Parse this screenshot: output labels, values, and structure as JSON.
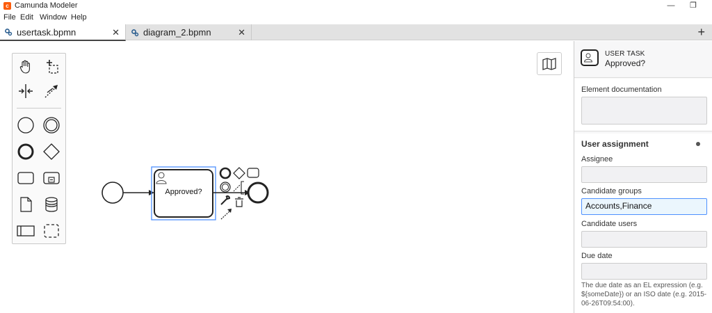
{
  "window": {
    "title": "Camunda Modeler",
    "minimize_glyph": "—",
    "restore_glyph": "❐"
  },
  "menu": [
    "File",
    "Edit",
    "Window",
    "Help"
  ],
  "tabs": [
    {
      "label": "usertask.bpmn",
      "active": true
    },
    {
      "label": "diagram_2.bpmn",
      "active": false
    }
  ],
  "tab_close_glyph": "✕",
  "add_tab_glyph": "+",
  "palette": {
    "tools": [
      "hand-tool-icon",
      "lasso-tool-icon",
      "space-tool-icon",
      "global-connect-icon",
      "start-event-icon",
      "intermediate-event-icon",
      "end-event-icon",
      "gateway-icon",
      "task-icon",
      "subprocess-icon",
      "data-object-icon",
      "data-store-icon",
      "pool-icon",
      "group-icon"
    ]
  },
  "diagram": {
    "task_label": "Approved?"
  },
  "properties": {
    "element_type": "USER TASK",
    "element_name": "Approved?",
    "documentation_label": "Element documentation",
    "documentation_value": "",
    "section_title": "User assignment",
    "fields": {
      "assignee_label": "Assignee",
      "assignee_value": "",
      "candidate_groups_label": "Candidate groups",
      "candidate_groups_value": "Accounts,Finance",
      "candidate_users_label": "Candidate users",
      "candidate_users_value": "",
      "due_date_label": "Due date",
      "due_date_value": ""
    },
    "due_date_help": "The due date as an EL expression (e.g. ${someDate}) or an ISO date (e.g. 2015-06-26T09:54:00)."
  },
  "colors": {
    "brand": "#fc5d0d",
    "selection": "#4d90fe",
    "focused_input_bg": "#ebf6fd"
  }
}
